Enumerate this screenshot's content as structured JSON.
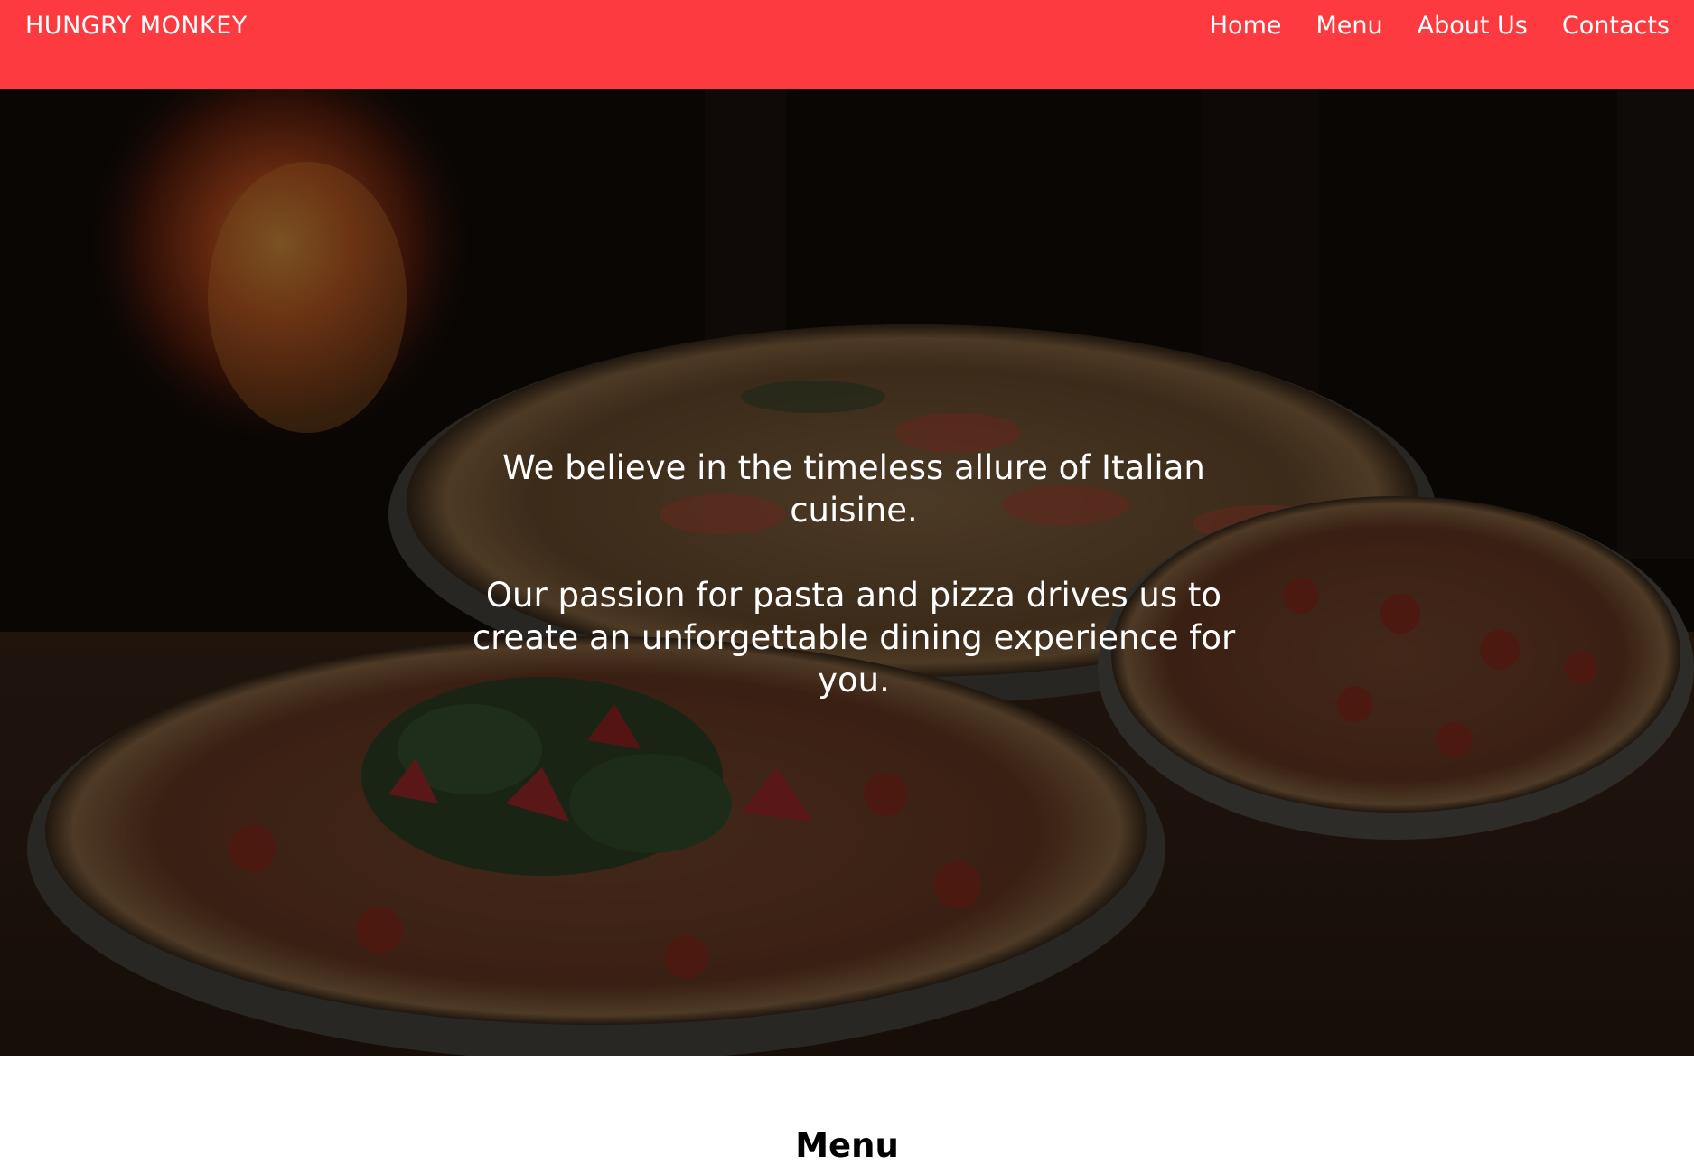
{
  "nav": {
    "brand": "HUNGRY MONKEY",
    "links": [
      "Home",
      "Menu",
      "About Us",
      "Contacts"
    ]
  },
  "hero": {
    "paragraphs": [
      "We believe in the timeless allure of Italian cuisine.",
      "Our passion for pasta and pizza drives us to create an unforgettable dining experience for you."
    ],
    "background_image": "pizza-oven-photo"
  },
  "menu_section": {
    "heading": "Menu"
  },
  "colors": {
    "navbar": "#fd3a3f",
    "hero_overlay": "#1a0f0b",
    "text_light": "#ffffff",
    "text_dark": "#000000"
  }
}
